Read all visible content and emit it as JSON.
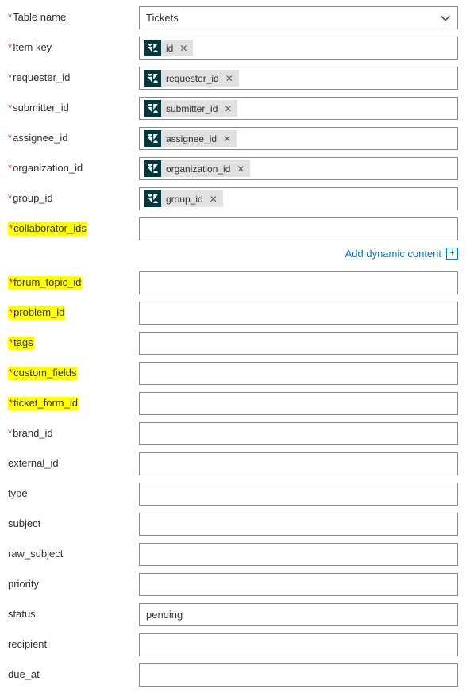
{
  "rows": [
    {
      "label": "Table name",
      "required": true,
      "highlight": false,
      "type": "select",
      "value": "Tickets"
    },
    {
      "label": "Item key",
      "required": true,
      "highlight": false,
      "type": "token",
      "token": "id"
    },
    {
      "label": "requester_id",
      "required": true,
      "highlight": false,
      "type": "token",
      "token": "requester_id"
    },
    {
      "label": "submitter_id",
      "required": true,
      "highlight": false,
      "type": "token",
      "token": "submitter_id"
    },
    {
      "label": "assignee_id",
      "required": true,
      "highlight": false,
      "type": "token",
      "token": "assignee_id"
    },
    {
      "label": "organization_id",
      "required": true,
      "highlight": false,
      "type": "token",
      "token": "organization_id"
    },
    {
      "label": "group_id",
      "required": true,
      "highlight": false,
      "type": "token",
      "token": "group_id"
    },
    {
      "label": "collaborator_ids",
      "required": true,
      "highlight": true,
      "type": "empty"
    }
  ],
  "add_dynamic_label": "Add dynamic content",
  "rows2": [
    {
      "label": "forum_topic_id",
      "required": true,
      "highlight": true,
      "type": "empty"
    },
    {
      "label": "problem_id",
      "required": true,
      "highlight": true,
      "type": "empty"
    },
    {
      "label": "tags",
      "required": true,
      "highlight": true,
      "type": "empty"
    },
    {
      "label": "custom_fields",
      "required": true,
      "highlight": true,
      "type": "empty"
    },
    {
      "label": "ticket_form_id",
      "required": true,
      "highlight": true,
      "type": "empty"
    },
    {
      "label": "brand_id",
      "required": true,
      "highlight": false,
      "type": "empty"
    },
    {
      "label": "external_id",
      "required": false,
      "highlight": false,
      "type": "empty"
    },
    {
      "label": "type",
      "required": false,
      "highlight": false,
      "type": "empty"
    },
    {
      "label": "subject",
      "required": false,
      "highlight": false,
      "type": "empty"
    },
    {
      "label": "raw_subject",
      "required": false,
      "highlight": false,
      "type": "empty"
    },
    {
      "label": "priority",
      "required": false,
      "highlight": false,
      "type": "empty"
    },
    {
      "label": "status",
      "required": false,
      "highlight": false,
      "type": "text",
      "value": "pending"
    },
    {
      "label": "recipient",
      "required": false,
      "highlight": false,
      "type": "empty"
    },
    {
      "label": "due_at",
      "required": false,
      "highlight": false,
      "type": "empty"
    }
  ]
}
